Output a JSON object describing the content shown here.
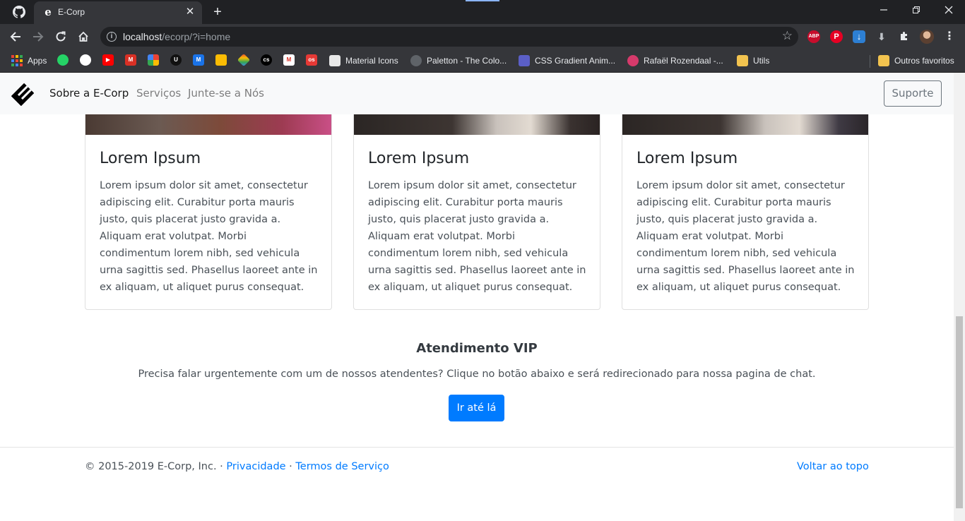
{
  "browser": {
    "tab_title": "E-Corp",
    "tab_favicon": "e",
    "url_host": "localhost",
    "url_path": "/ecorp/?i=home",
    "extensions": [
      {
        "name": "adblock-plus-icon",
        "label": "ABP",
        "color": "#c70d2c"
      },
      {
        "name": "pinterest-icon",
        "label": "P",
        "color": "#e60023"
      },
      {
        "name": "download-manager-icon",
        "label": "↓",
        "color": "#2d7fd3"
      }
    ],
    "bookmarks": [
      {
        "label": "Apps",
        "icon": "apps-grid-icon"
      },
      {
        "label": "Material Icons",
        "icon": "material-icons-favicon",
        "color": "#e8e8e8"
      },
      {
        "label": "Paletton - The Colo...",
        "icon": "paletton-favicon",
        "color": "#5f6368"
      },
      {
        "label": "CSS Gradient Anim...",
        "icon": "css-gradient-favicon",
        "color": "#5b5fc7"
      },
      {
        "label": "Rafaël Rozendaal -...",
        "icon": "rozendaal-favicon",
        "color": "#d63a6b"
      },
      {
        "label": "Utils",
        "icon": "folder-icon",
        "color": "#f2c34f"
      },
      {
        "label": "Outros favoritos",
        "icon": "folder-icon",
        "color": "#f2c34f"
      }
    ],
    "bookmark_icons": [
      {
        "name": "whatsapp-favicon",
        "color": "#25d366",
        "glyph": ""
      },
      {
        "name": "github-favicon",
        "color": "#ffffff",
        "glyph": ""
      },
      {
        "name": "youtube-favicon",
        "color": "#ff0000",
        "glyph": "▶"
      },
      {
        "name": "gmail-red-favicon",
        "color": "#d93025",
        "glyph": "M"
      },
      {
        "name": "pinwheel-favicon",
        "color": "#34a853",
        "glyph": ""
      },
      {
        "name": "dark-app-favicon",
        "color": "#111111",
        "glyph": "U"
      },
      {
        "name": "m-blue-favicon",
        "color": "#1a73e8",
        "glyph": "M"
      },
      {
        "name": "keep-favicon",
        "color": "#fbbc04",
        "glyph": ""
      },
      {
        "name": "diamond-favicon",
        "color": "#7e57c2",
        "glyph": ""
      },
      {
        "name": "cs-favicon",
        "color": "#000000",
        "glyph": "cs"
      },
      {
        "name": "gmail-favicon",
        "color": "#ffffff",
        "glyph": "M"
      },
      {
        "name": "os-favicon",
        "color": "#e53935",
        "glyph": "os"
      }
    ]
  },
  "site": {
    "nav": {
      "links": [
        "Sobre a E-Corp",
        "Serviços",
        "Junte-se a Nós"
      ],
      "support_button": "Suporte"
    },
    "cards": [
      {
        "title": "Lorem Ipsum",
        "text": "Lorem ipsum dolor sit amet, consectetur adipiscing elit. Curabitur porta mauris justo, quis placerat justo gravida a. Aliquam erat volutpat. Morbi condimentum lorem nibh, sed vehicula urna sagittis sed. Phasellus laoreet ante in ex aliquam, ut aliquet purus consequat."
      },
      {
        "title": "Lorem Ipsum",
        "text": "Lorem ipsum dolor sit amet, consectetur adipiscing elit. Curabitur porta mauris justo, quis placerat justo gravida a. Aliquam erat volutpat. Morbi condimentum lorem nibh, sed vehicula urna sagittis sed. Phasellus laoreet ante in ex aliquam, ut aliquet purus consequat."
      },
      {
        "title": "Lorem Ipsum",
        "text": "Lorem ipsum dolor sit amet, consectetur adipiscing elit. Curabitur porta mauris justo, quis placerat justo gravida a. Aliquam erat volutpat. Morbi condimentum lorem nibh, sed vehicula urna sagittis sed. Phasellus laoreet ante in ex aliquam, ut aliquet purus consequat."
      }
    ],
    "vip": {
      "title": "Atendimento VIP",
      "text": "Precisa falar urgentemente com um de nossos atendentes? Clique no botão abaixo e será redirecionado para nossa pagina de chat.",
      "button": "Ir até lá",
      "button_color": "#007bff"
    },
    "footer": {
      "copyright": "© 2015-2019 E-Corp, Inc.",
      "separator": " · ",
      "privacy": "Privacidade",
      "terms": "Termos de Serviço",
      "back_to_top": "Voltar ao topo",
      "link_color": "#007bff"
    }
  }
}
